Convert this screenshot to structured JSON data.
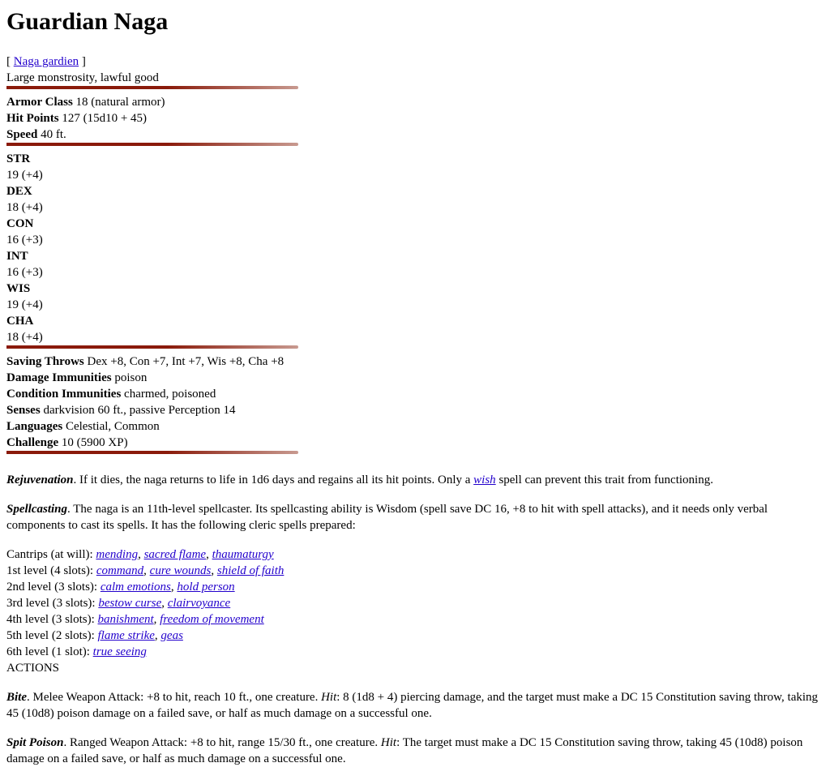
{
  "title": "Guardian Naga",
  "translation": {
    "open": "[ ",
    "link": "Naga gardien",
    "close": " ]"
  },
  "type_line": "Large monstrosity, lawful good",
  "basics": [
    {
      "label": "Armor Class",
      "value": " 18 (natural armor)"
    },
    {
      "label": "Hit Points",
      "value": " 127 (15d10 + 45)"
    },
    {
      "label": "Speed",
      "value": " 40 ft."
    }
  ],
  "abilities": [
    {
      "name": "STR",
      "score": "19 (+4)"
    },
    {
      "name": "DEX",
      "score": "18 (+4)"
    },
    {
      "name": "CON",
      "score": "16 (+3)"
    },
    {
      "name": "INT",
      "score": "16 (+3)"
    },
    {
      "name": "WIS",
      "score": "19 (+4)"
    },
    {
      "name": "CHA",
      "score": "18 (+4)"
    }
  ],
  "details": [
    {
      "label": "Saving Throws",
      "value": " Dex +8, Con +7, Int +7, Wis +8, Cha +8"
    },
    {
      "label": "Damage Immunities",
      "value": " poison"
    },
    {
      "label": "Condition Immunities",
      "value": " charmed, poisoned"
    },
    {
      "label": "Senses",
      "value": " darkvision 60 ft., passive Perception 14"
    },
    {
      "label": "Languages",
      "value": " Celestial, Common"
    },
    {
      "label": "Challenge",
      "value": " 10 (5900 XP)"
    }
  ],
  "rejuvenation": {
    "name": "Rejuvenation",
    "text_a": ". If it dies, the naga returns to life in 1d6 days and regains all its hit points. Only a ",
    "link": "wish",
    "text_b": " spell can prevent this trait from functioning."
  },
  "spellcasting": {
    "name": "Spellcasting",
    "text": ". The naga is an 11th-level spellcaster. Its spellcasting ability is Wisdom (spell save DC 16, +8 to hit with spell attacks), and it needs only verbal components to cast its spells. It has the following cleric spells prepared:"
  },
  "spell_levels": [
    {
      "label": "Cantrips (at will): ",
      "spells": [
        "mending",
        "sacred flame",
        "thaumaturgy"
      ]
    },
    {
      "label": "1st level (4 slots): ",
      "spells": [
        "command",
        "cure wounds",
        "shield of faith"
      ]
    },
    {
      "label": "2nd level (3 slots): ",
      "spells": [
        "calm emotions",
        "hold person"
      ]
    },
    {
      "label": "3rd level (3 slots): ",
      "spells": [
        "bestow curse",
        "clairvoyance"
      ]
    },
    {
      "label": "4th level (3 slots): ",
      "spells": [
        "banishment",
        "freedom of movement"
      ]
    },
    {
      "label": "5th level (2 slots): ",
      "spells": [
        "flame strike",
        "geas"
      ]
    },
    {
      "label": "6th level (1 slot): ",
      "spells": [
        "true seeing"
      ]
    }
  ],
  "actions_heading": "ACTIONS",
  "bite": {
    "name": "Bite",
    "text_a": ". Melee Weapon Attack: +8 to hit, reach 10 ft., one creature. ",
    "hit": "Hit",
    "text_b": ": 8 (1d8 + 4) piercing damage, and the target must make a DC 15 Constitution saving throw, taking 45 (10d8) poison damage on a failed save, or half as much damage on a successful one."
  },
  "spit": {
    "name": "Spit Poison",
    "text_a": ". Ranged Weapon Attack: +8 to hit, range 15/30 ft., one creature. ",
    "hit": "Hit",
    "text_b": ": The target must make a DC 15 Constitution saving throw, taking 45 (10d8) poison damage on a failed save, or half as much damage on a successful one."
  }
}
